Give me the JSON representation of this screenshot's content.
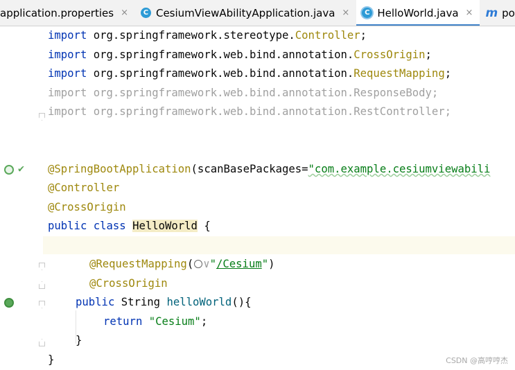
{
  "tabs": [
    {
      "label": "application.properties",
      "icon": "properties-file-icon",
      "active": false
    },
    {
      "label": "CesiumViewAbilityApplication.java",
      "icon": "java-class-icon",
      "active": false
    },
    {
      "label": "HelloWorld.java",
      "icon": "java-class-icon",
      "active": true
    },
    {
      "label": "po",
      "icon": "maven-m-icon",
      "active": false
    }
  ],
  "tab_close_glyph": "×",
  "icons": {
    "class_letter": "C",
    "maven_letter": "m"
  },
  "code": {
    "imp1": {
      "kw": "import",
      "pkg": " org.springframework.stereotype.",
      "cls": "Controller",
      "end": ";"
    },
    "imp2": {
      "kw": "import",
      "pkg": " org.springframework.web.bind.annotation.",
      "cls": "CrossOrigin",
      "end": ";"
    },
    "imp3": {
      "kw": "import",
      "pkg": " org.springframework.web.bind.annotation.",
      "cls": "RequestMapping",
      "end": ";"
    },
    "imp4": "import org.springframework.web.bind.annotation.ResponseBody;",
    "imp5": "import org.springframework.web.bind.annotation.RestController;",
    "ann1": {
      "name": "@SpringBootApplication",
      "open": "(scanBasePackages=",
      "value": "\"com.example.cesiumviewabili"
    },
    "ann2": "@Controller",
    "ann3": "@CrossOrigin",
    "class_decl": {
      "mods": "public class ",
      "name": "HelloWorld",
      "brace": " {"
    },
    "method_ann": {
      "name": "@RequestMapping",
      "paren_open": "(",
      "chevron": "∨",
      "quote_open": "\"",
      "path": "/Cesium",
      "quote_close": "\"",
      "paren_close": ")"
    },
    "method_ann2": "@CrossOrigin",
    "method_sig": {
      "mods": "public ",
      "type": "String ",
      "name": "helloWorld",
      "rest": "(){"
    },
    "return_stmt": {
      "kw": "return ",
      "value": "\"Cesium\"",
      "end": ";"
    },
    "method_close": "}",
    "class_close": "}"
  },
  "watermark": "CSDN @高哼哼杰"
}
